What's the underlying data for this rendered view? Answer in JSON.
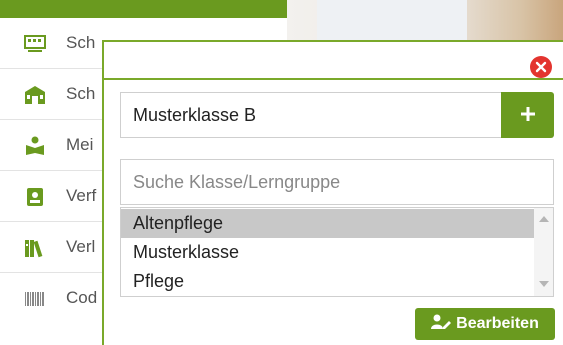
{
  "sidebar": {
    "items": [
      {
        "label": "Sch",
        "icon": "classroom-board-icon"
      },
      {
        "label": "Sch",
        "icon": "school-building-icon"
      },
      {
        "label": "Mei",
        "icon": "reading-person-icon"
      },
      {
        "label": "Verf",
        "icon": "contact-card-icon"
      },
      {
        "label": "Verl",
        "icon": "books-icon"
      },
      {
        "label": "Cod",
        "icon": "barcode-icon"
      }
    ]
  },
  "dialog": {
    "class_input_value": "Musterklasse B",
    "add_button_icon": "plus-icon",
    "search_placeholder": "Suche Klasse/Lerngruppe",
    "options": [
      "Altenpflege",
      "Musterklasse",
      "Pflege"
    ],
    "selected_option": "Altenpflege",
    "edit_button_label": "Bearbeiten",
    "edit_button_icon": "user-edit-icon",
    "close_icon": "close-icon"
  },
  "colors": {
    "accent": "#6a9a1f",
    "close": "#e3342f"
  }
}
